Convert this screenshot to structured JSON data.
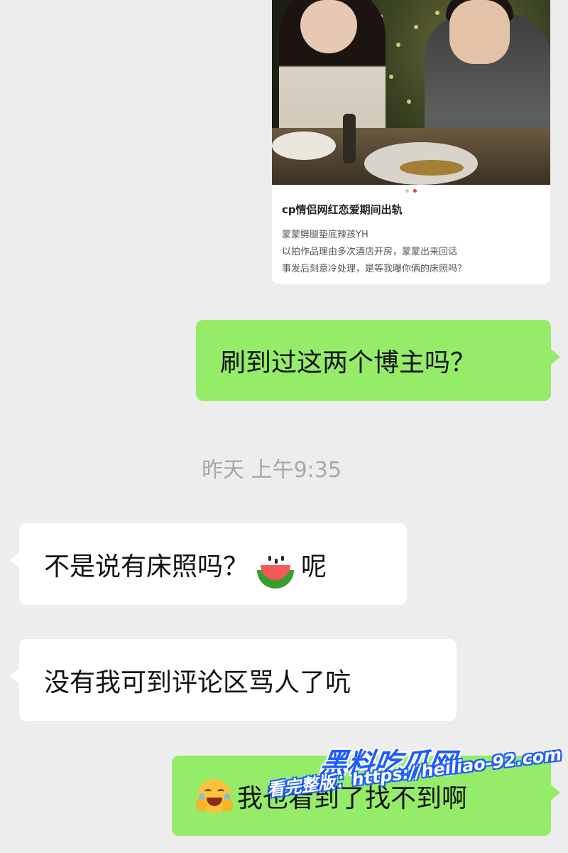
{
  "shared_card": {
    "title": "cp情侣网红恋爱期间出轨",
    "lines": [
      "蒙蒙劈腿垫底辣孩YH",
      "以拍作品理由多次酒店开房，蒙蒙出来回话",
      "事发后刻意冷处理，是等我曝你俩的床照吗？"
    ],
    "image_count": 2,
    "active_image_index": 2
  },
  "messages": [
    {
      "side": "right",
      "text": "刷到过这两个博主吗？"
    },
    {
      "side": "left",
      "text_before": "不是说有床照吗？",
      "emoji": "watermelon",
      "text_after": "呢"
    },
    {
      "side": "left",
      "text": "没有我可到评论区骂人了吭"
    },
    {
      "side": "right",
      "emoji": "face-with-tears-of-joy-hands",
      "text": "我也看到了找不到啊"
    }
  ],
  "timestamp": "昨天 上午9:35",
  "watermark": {
    "brand": "黑料吃瓜网",
    "url_line": "看完整版：https://heiliao-92.com"
  },
  "colors": {
    "background": "#ededed",
    "bubble_right": "#95ec69",
    "bubble_left": "#ffffff"
  }
}
